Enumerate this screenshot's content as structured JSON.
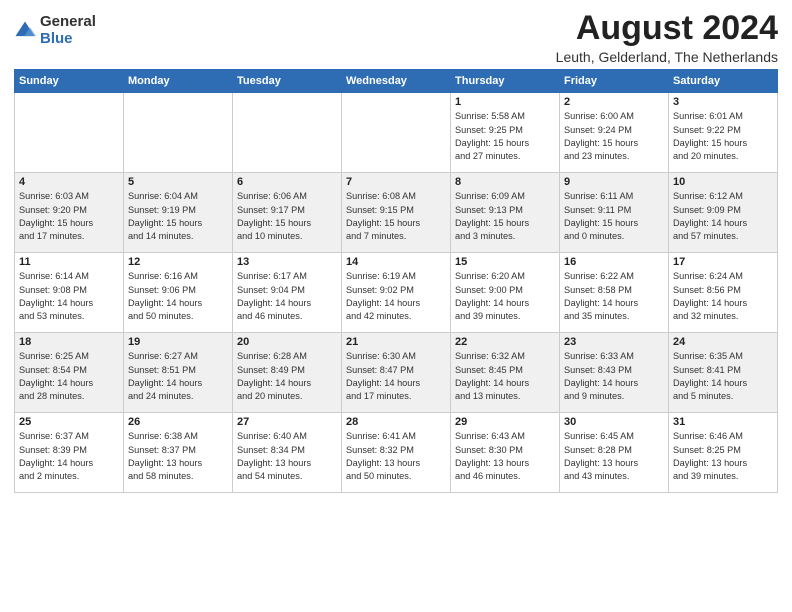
{
  "logo": {
    "general": "General",
    "blue": "Blue"
  },
  "title": "August 2024",
  "location": "Leuth, Gelderland, The Netherlands",
  "days_header": [
    "Sunday",
    "Monday",
    "Tuesday",
    "Wednesday",
    "Thursday",
    "Friday",
    "Saturday"
  ],
  "weeks": [
    [
      {
        "day": "",
        "info": ""
      },
      {
        "day": "",
        "info": ""
      },
      {
        "day": "",
        "info": ""
      },
      {
        "day": "",
        "info": ""
      },
      {
        "day": "1",
        "info": "Sunrise: 5:58 AM\nSunset: 9:25 PM\nDaylight: 15 hours\nand 27 minutes."
      },
      {
        "day": "2",
        "info": "Sunrise: 6:00 AM\nSunset: 9:24 PM\nDaylight: 15 hours\nand 23 minutes."
      },
      {
        "day": "3",
        "info": "Sunrise: 6:01 AM\nSunset: 9:22 PM\nDaylight: 15 hours\nand 20 minutes."
      }
    ],
    [
      {
        "day": "4",
        "info": "Sunrise: 6:03 AM\nSunset: 9:20 PM\nDaylight: 15 hours\nand 17 minutes."
      },
      {
        "day": "5",
        "info": "Sunrise: 6:04 AM\nSunset: 9:19 PM\nDaylight: 15 hours\nand 14 minutes."
      },
      {
        "day": "6",
        "info": "Sunrise: 6:06 AM\nSunset: 9:17 PM\nDaylight: 15 hours\nand 10 minutes."
      },
      {
        "day": "7",
        "info": "Sunrise: 6:08 AM\nSunset: 9:15 PM\nDaylight: 15 hours\nand 7 minutes."
      },
      {
        "day": "8",
        "info": "Sunrise: 6:09 AM\nSunset: 9:13 PM\nDaylight: 15 hours\nand 3 minutes."
      },
      {
        "day": "9",
        "info": "Sunrise: 6:11 AM\nSunset: 9:11 PM\nDaylight: 15 hours\nand 0 minutes."
      },
      {
        "day": "10",
        "info": "Sunrise: 6:12 AM\nSunset: 9:09 PM\nDaylight: 14 hours\nand 57 minutes."
      }
    ],
    [
      {
        "day": "11",
        "info": "Sunrise: 6:14 AM\nSunset: 9:08 PM\nDaylight: 14 hours\nand 53 minutes."
      },
      {
        "day": "12",
        "info": "Sunrise: 6:16 AM\nSunset: 9:06 PM\nDaylight: 14 hours\nand 50 minutes."
      },
      {
        "day": "13",
        "info": "Sunrise: 6:17 AM\nSunset: 9:04 PM\nDaylight: 14 hours\nand 46 minutes."
      },
      {
        "day": "14",
        "info": "Sunrise: 6:19 AM\nSunset: 9:02 PM\nDaylight: 14 hours\nand 42 minutes."
      },
      {
        "day": "15",
        "info": "Sunrise: 6:20 AM\nSunset: 9:00 PM\nDaylight: 14 hours\nand 39 minutes."
      },
      {
        "day": "16",
        "info": "Sunrise: 6:22 AM\nSunset: 8:58 PM\nDaylight: 14 hours\nand 35 minutes."
      },
      {
        "day": "17",
        "info": "Sunrise: 6:24 AM\nSunset: 8:56 PM\nDaylight: 14 hours\nand 32 minutes."
      }
    ],
    [
      {
        "day": "18",
        "info": "Sunrise: 6:25 AM\nSunset: 8:54 PM\nDaylight: 14 hours\nand 28 minutes."
      },
      {
        "day": "19",
        "info": "Sunrise: 6:27 AM\nSunset: 8:51 PM\nDaylight: 14 hours\nand 24 minutes."
      },
      {
        "day": "20",
        "info": "Sunrise: 6:28 AM\nSunset: 8:49 PM\nDaylight: 14 hours\nand 20 minutes."
      },
      {
        "day": "21",
        "info": "Sunrise: 6:30 AM\nSunset: 8:47 PM\nDaylight: 14 hours\nand 17 minutes."
      },
      {
        "day": "22",
        "info": "Sunrise: 6:32 AM\nSunset: 8:45 PM\nDaylight: 14 hours\nand 13 minutes."
      },
      {
        "day": "23",
        "info": "Sunrise: 6:33 AM\nSunset: 8:43 PM\nDaylight: 14 hours\nand 9 minutes."
      },
      {
        "day": "24",
        "info": "Sunrise: 6:35 AM\nSunset: 8:41 PM\nDaylight: 14 hours\nand 5 minutes."
      }
    ],
    [
      {
        "day": "25",
        "info": "Sunrise: 6:37 AM\nSunset: 8:39 PM\nDaylight: 14 hours\nand 2 minutes."
      },
      {
        "day": "26",
        "info": "Sunrise: 6:38 AM\nSunset: 8:37 PM\nDaylight: 13 hours\nand 58 minutes."
      },
      {
        "day": "27",
        "info": "Sunrise: 6:40 AM\nSunset: 8:34 PM\nDaylight: 13 hours\nand 54 minutes."
      },
      {
        "day": "28",
        "info": "Sunrise: 6:41 AM\nSunset: 8:32 PM\nDaylight: 13 hours\nand 50 minutes."
      },
      {
        "day": "29",
        "info": "Sunrise: 6:43 AM\nSunset: 8:30 PM\nDaylight: 13 hours\nand 46 minutes."
      },
      {
        "day": "30",
        "info": "Sunrise: 6:45 AM\nSunset: 8:28 PM\nDaylight: 13 hours\nand 43 minutes."
      },
      {
        "day": "31",
        "info": "Sunrise: 6:46 AM\nSunset: 8:25 PM\nDaylight: 13 hours\nand 39 minutes."
      }
    ]
  ]
}
